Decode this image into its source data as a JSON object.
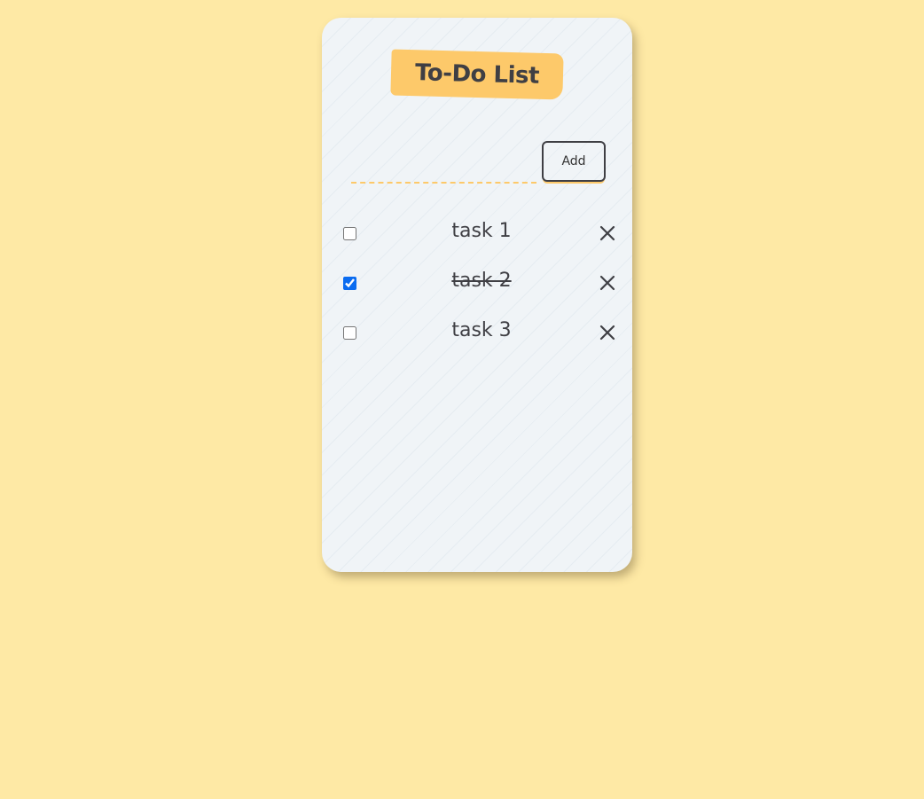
{
  "app": {
    "title": "To-Do List"
  },
  "form": {
    "input_value": "",
    "input_placeholder": "",
    "add_label": "Add"
  },
  "tasks": [
    {
      "label": "task 1",
      "done": false
    },
    {
      "label": "task 2",
      "done": true
    },
    {
      "label": "task 3",
      "done": false
    }
  ],
  "icons": {
    "delete": "close-icon"
  },
  "colors": {
    "background": "#fee9a5",
    "card": "#f0f4f7",
    "accent": "#fdc96a",
    "text": "#3f3f44",
    "checkbox": "#0b6cf0"
  }
}
